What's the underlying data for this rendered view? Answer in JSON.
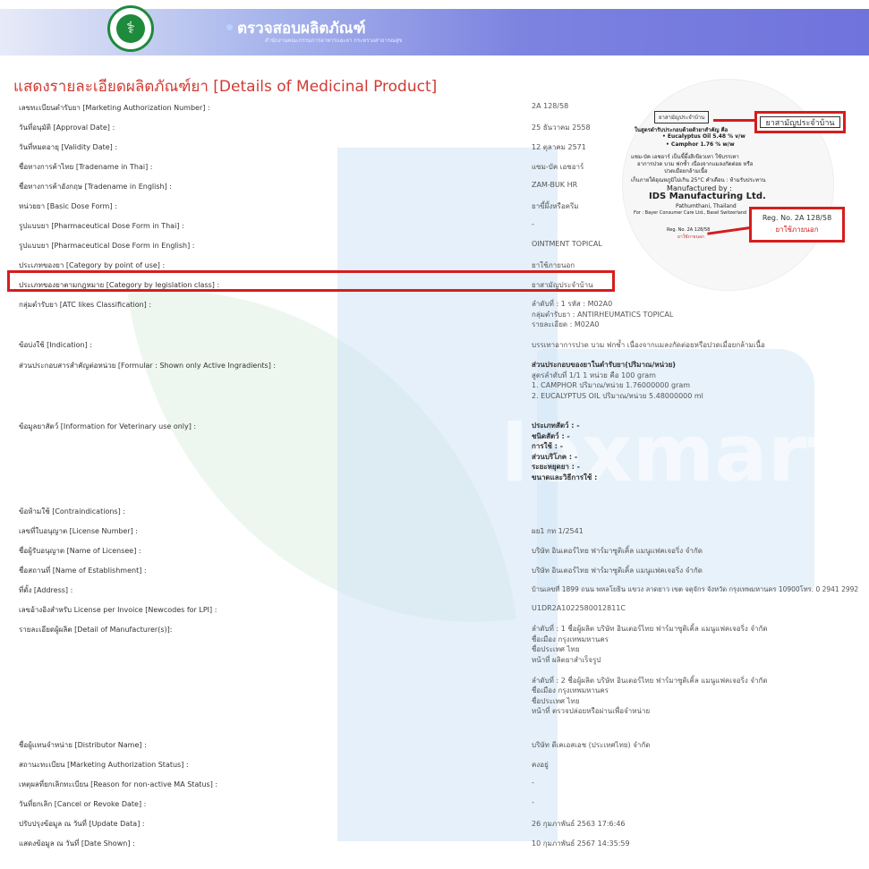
{
  "header": {
    "title": "ตรวจสอบผลิตภัณฑ์",
    "subtitle": "สำนักงานคณะกรรมการอาหารและยา กระทรวงสาธารณสุข"
  },
  "page_title": "แสดงรายละเอียดผลิตภัณฑ์ยา [Details of Medicinal Product]",
  "watermark": "lexmart",
  "rows": [
    {
      "label": "เลขทะเบียนตำรับยา [Marketing Authorization Number] :",
      "value": "2A 128/58"
    },
    {
      "label": "วันที่อนุมัติ [Approval Date] :",
      "value": "25 ธันวาคม 2558"
    },
    {
      "label": "วันที่หมดอายุ [Validity Date] :",
      "value": "12 ตุลาคม 2571"
    },
    {
      "label": "ชื่อทางการค้าไทย [Tradename in Thai] :",
      "value": "แซม-บัค เอชอาร์"
    },
    {
      "label": "ชื่อทางการค้าอังกฤษ [Tradename in English] :",
      "value": "ZAM-BUK HR"
    },
    {
      "label": "หน่วยยา [Basic Dose Form] :",
      "value": "ยาขี้ผึ้งหรือครีม"
    },
    {
      "label": "รูปแบบยา [Pharmaceutical Dose Form in Thai] :",
      "value": "-"
    },
    {
      "label": "รูปแบบยา [Pharmaceutical Dose Form in English] :",
      "value": "OINTMENT TOPICAL"
    },
    {
      "label": "ประเภทของยา [Category by point of use] :",
      "value": "ยาใช้ภายนอก"
    },
    {
      "label": "ประเภทของยาตามกฎหมาย [Category by legislation class] :",
      "value": "ยาสามัญประจำบ้าน"
    }
  ],
  "atc": {
    "label": "กลุ่มตำรับยา [ATC likes Classification] :",
    "line1": "ลำดับที่ : 1 รหัส : M02A0",
    "line2": "กลุ่มตำรับยา : ANTIRHEUMATICS TOPICAL",
    "line3": "รายละเอียด : M02A0"
  },
  "indication": {
    "label": "ข้อบ่งใช้ [Indication] :",
    "value": "บรรเทาอาการปวด บวม ฟกช้ำ เนื่องจากแมลงกัดต่อยหรือปวดเมื่อยกล้ามเนื้อ"
  },
  "formula": {
    "label": "ส่วนประกอบสารสำคัญต่อหน่วย [Formular : Shown only Active Ingradients] :",
    "title": "ส่วนประกอบของยาในตำรับยา(ปริมาณ/หน่วย)",
    "line1": "สูตรลำดับที่ 1/1 1 หน่วย คือ 100 gram",
    "line2": "1. CAMPHOR      ปริมาณ/หน่วย  1.76000000 gram",
    "line3": "2. EUCALYPTUS OIL      ปริมาณ/หน่วย  5.48000000 ml"
  },
  "veterinary": {
    "label": "ข้อมูลยาสัตว์ [Information for Veterinary use only] :",
    "lines": [
      "ประเภทสัตว์ : -",
      "ชนิดสัตว์ : -",
      "การใช้ : -",
      "ส่วนบริโภค : -",
      "ระยะหยุดยา : -",
      "ขนาดและวิธีการใช้ :"
    ]
  },
  "contraindications": {
    "label": "ข้อห้ามใช้ [Contraindications] :",
    "value": ""
  },
  "rows2": [
    {
      "label": "เลขที่ใบอนุญาต [License Number] :",
      "value": "ผย1 กท 1/2541"
    },
    {
      "label": "ชื่อผู้รับอนุญาต [Name of Licensee] :",
      "value": "บริษัท อินเตอร์ไทย ฟาร์มาซูติเคิ้ล แมนูแฟคเจอริ่ง จำกัด"
    },
    {
      "label": "ชื่อสถานที่ [Name of Establishment] :",
      "value": "บริษัท อินเตอร์ไทย ฟาร์มาซูติเคิ้ล แมนูแฟคเจอริ่ง จำกัด"
    },
    {
      "label": "ที่ตั้ง [Address] :",
      "value": "บ้านเลขที่ 1899 ถนน พหลโยธิน แขวง ลาดยาว เขต จตุจักร จังหวัด กรุงเทพมหานคร 10900โทร. 0 2941 2992"
    },
    {
      "label": "เลขอ้างอิงสำหรับ License per Invoice [Newcodes for LPI] :",
      "value": "U1DR2A1022580012811C"
    }
  ],
  "manufacturer": {
    "label": "รายละเอียดผู้ผลิต [Detail of Manufacturer(s)]:",
    "m1": {
      "l1": "ลำดับที่ : 1 ชื่อผู้ผลิต บริษัท อินเตอร์ไทย ฟาร์มาซูติเคิ้ล แมนูแฟคเจอริ่ง จำกัด",
      "l2": "ชื่อเมือง กรุงเทพมหานคร",
      "l3": "ชื่อประเทศ ไทย",
      "l4": "หน้าที่ ผลิตยาสำเร็จรูป"
    },
    "m2": {
      "l1": "ลำดับที่ : 2 ชื่อผู้ผลิต บริษัท อินเตอร์ไทย ฟาร์มาซูติเคิ้ล แมนูแฟคเจอริ่ง จำกัด",
      "l2": "ชื่อเมือง กรุงเทพมหานคร",
      "l3": "ชื่อประเทศ ไทย",
      "l4": "หน้าที่ ตรวจปล่อยหรือผ่านเพื่อจำหน่าย"
    }
  },
  "rows3": [
    {
      "label": "ชื่อผู้แทนจำหน่าย [Distributor Name] :",
      "value": "บริษัท ดีเคเอสเอช (ประเทศไทย) จำกัด"
    },
    {
      "label": "สถานะทะเบียน [Marketing Authorization Status] :",
      "value": "คงอยู่"
    },
    {
      "label": "เหตุผลที่ยกเลิกทะเบียน [Reason for non-active MA Status] :",
      "value": "-"
    },
    {
      "label": "วันที่ยกเลิก [Cancel or Revoke Date] :",
      "value": "-"
    },
    {
      "label": "ปรับปรุงข้อมูล ณ วันที่ [Update Data] :",
      "value": "26 กุมภาพันธ์ 2563 17:6:46"
    },
    {
      "label": "แสดงข้อมูล ณ วันที่ [Date Shown] :",
      "value": "10 กุมภาพันธ์ 2567 14:35:59"
    }
  ],
  "package": {
    "badge": "ยาสามัญประจำบ้าน",
    "l1": "ในสูตรตำรับประกอบด้วยตัวยาสำคัญ คือ",
    "l2": "• Eucalyptus Oil 5.48 % v/w",
    "l3": "• Camphor 1.76 % w/w",
    "l4": "แซม-บัค เอชอาร์ เป็นขี้ผึ้งสีเขียวเทา ใช้บรรเทา",
    "l5": "อาการปวด บวม ฟกช้ำ เนื่องจากแมลงกัดต่อย หรือ",
    "l6": "ปวดเมื่อยกล้ามเนื้อ",
    "l7": "เก็บภายใต้อุณหภูมิไม่เกิน 25°C  คำเตือน : ห้ามรับประทาน",
    "l8": "Manufactured by :",
    "l9": "IDS Manufacturing Ltd.",
    "l10": "Pathumthani, Thailand",
    "l11": "For : Bayer Consumer Care Ltd., Basel  Switzerland",
    "l12": "Reg. No. 2A 128/58",
    "l13": "ยาใช้ภายนอก",
    "callout1": "ยาสามัญประจำบ้าน",
    "callout2_l1": "Reg. No. 2A 128/58",
    "callout2_l2": "ยาใช้ภายนอก"
  }
}
